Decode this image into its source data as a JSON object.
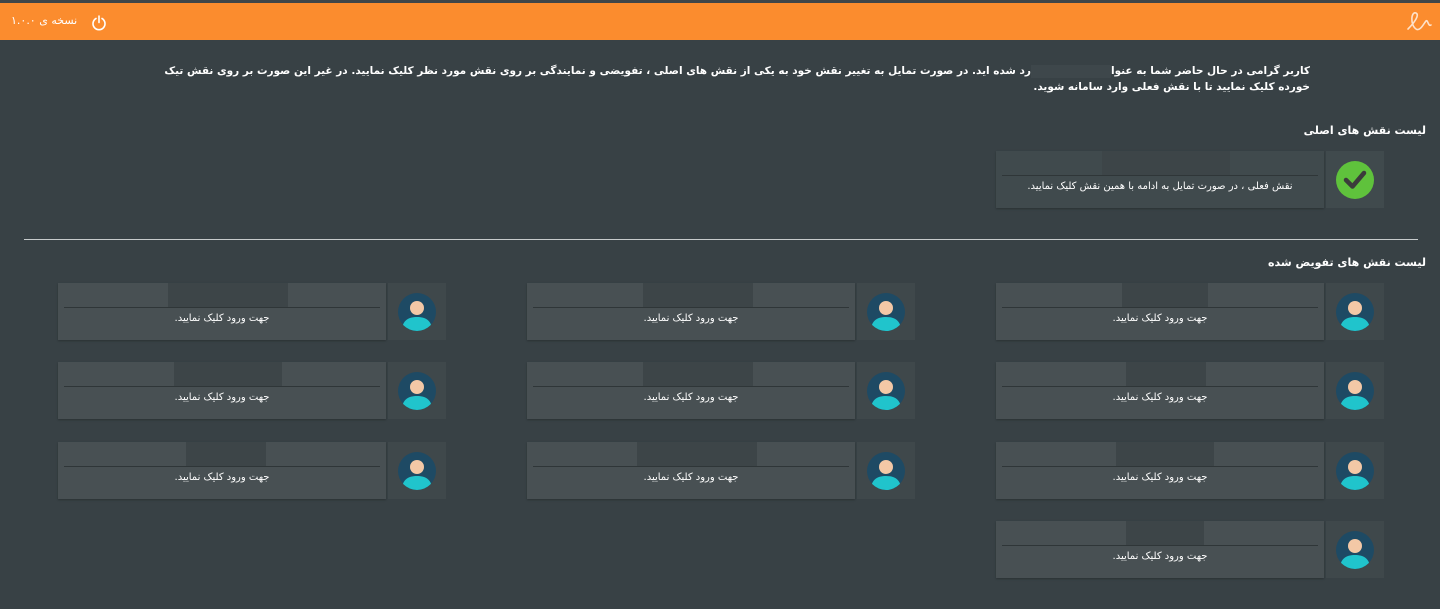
{
  "header": {
    "version_label": "نسخه ی ۱.۰.۰",
    "power_icon": "power-icon",
    "logo_icon": "app-logo-icon",
    "bar_color": "#fb8c2e"
  },
  "notice": {
    "text_before_mask": "کاربر گرامی در حال حاضر شما به عنوا",
    "text_after_mask": "رد شده اید. در صورت تمایل به تغییر نقش خود به یکی از نقش های اصلی ، تفویضی و نمایندگی بر روی نقش مورد نظر کلیک نمایید. در غیر این صورت بر روی نقش تیک خورده کلیک نمایید تا با نقش فعلی وارد سامانه شوید."
  },
  "primary_roles": {
    "title": "لیست نقش های اصلی",
    "items": [
      {
        "hint": "نقش فعلی ، در صورت تمایل به ادامه با همین نقش کلیک نمایید.",
        "icon": "check-circle-icon",
        "icon_color": "#5fc23c"
      }
    ]
  },
  "delegated_roles": {
    "title": "لیست نقش های تفویض شده",
    "items": [
      {
        "hint": "جهت ورود کلیک نمایید.",
        "icon": "user-avatar-icon"
      },
      {
        "hint": "جهت ورود کلیک نمایید.",
        "icon": "user-avatar-icon"
      },
      {
        "hint": "جهت ورود کلیک نمایید.",
        "icon": "user-avatar-icon"
      },
      {
        "hint": "جهت ورود کلیک نمایید.",
        "icon": "user-avatar-icon"
      },
      {
        "hint": "جهت ورود کلیک نمایید.",
        "icon": "user-avatar-icon"
      },
      {
        "hint": "جهت ورود کلیک نمایید.",
        "icon": "user-avatar-icon"
      },
      {
        "hint": "جهت ورود کلیک نمایید.",
        "icon": "user-avatar-icon"
      },
      {
        "hint": "جهت ورود کلیک نمایید.",
        "icon": "user-avatar-icon"
      },
      {
        "hint": "جهت ورود کلیک نمایید.",
        "icon": "user-avatar-icon"
      },
      {
        "hint": "جهت ورود کلیک نمایید.",
        "icon": "user-avatar-icon"
      }
    ]
  }
}
